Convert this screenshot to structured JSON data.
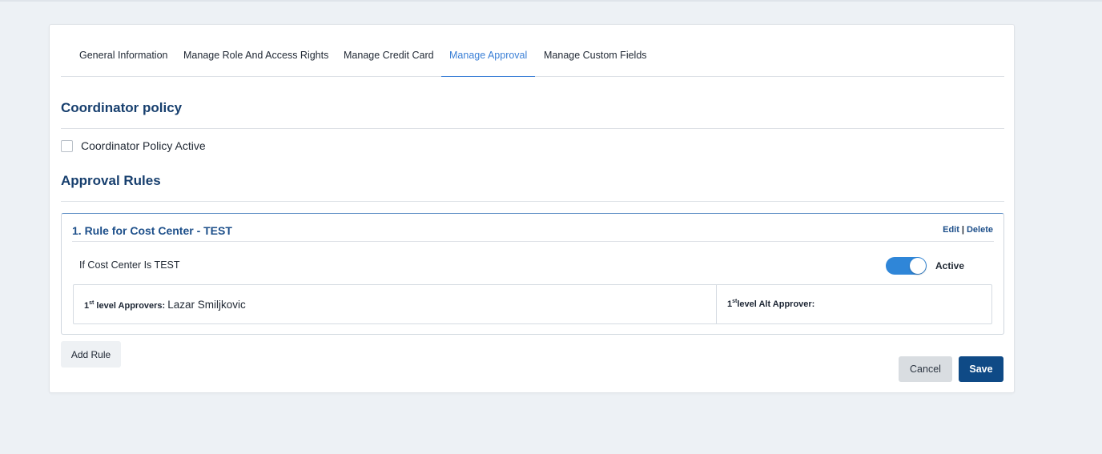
{
  "tabs": [
    {
      "label": "General Information"
    },
    {
      "label": "Manage Role And Access Rights"
    },
    {
      "label": "Manage Credit Card"
    },
    {
      "label": "Manage Approval"
    },
    {
      "label": "Manage Custom Fields"
    }
  ],
  "active_tab": "Manage Approval",
  "coordinator": {
    "title": "Coordinator policy",
    "checkbox_label": "Coordinator Policy Active",
    "checked": false
  },
  "approval": {
    "title": "Approval Rules",
    "rule": {
      "title": "1. Rule for Cost Center - TEST",
      "edit_label": "Edit",
      "separator": "|",
      "delete_label": "Delete",
      "condition": "If Cost Center Is TEST",
      "toggle_label": "Active",
      "toggle_on": true,
      "level_sup": "st",
      "approvers_label": "level Approvers:",
      "approvers_value": "Lazar Smiljkovic",
      "alt_label": "level Alt Approver:",
      "level_num": "1"
    }
  },
  "buttons": {
    "add_rule": "Add Rule",
    "cancel": "Cancel",
    "save": "Save"
  },
  "colors": {
    "accent": "#3a7fd6",
    "heading": "#173f6e",
    "primary_button": "#0f4a86",
    "toggle": "#2f86d8"
  }
}
